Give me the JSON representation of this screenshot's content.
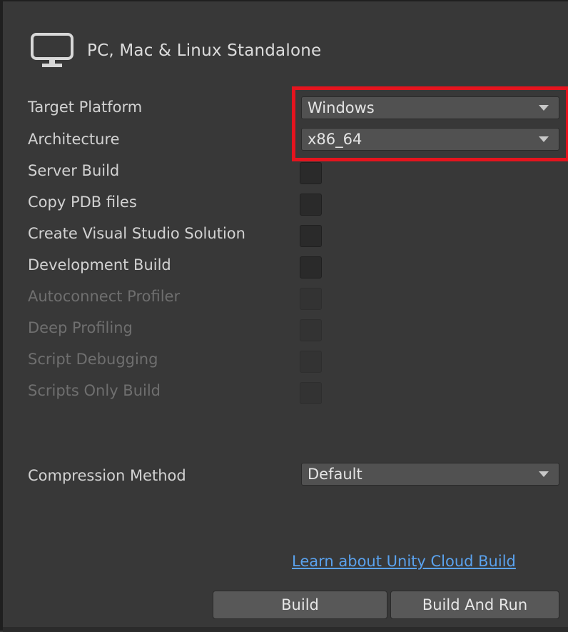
{
  "header": {
    "title": "PC, Mac & Linux Standalone",
    "icon": "monitor-icon"
  },
  "rows": {
    "target_platform": {
      "label": "Target Platform",
      "value": "Windows"
    },
    "architecture": {
      "label": "Architecture",
      "value": "x86_64"
    },
    "server_build": {
      "label": "Server Build"
    },
    "copy_pdb": {
      "label": "Copy PDB files"
    },
    "vs_solution": {
      "label": "Create Visual Studio Solution"
    },
    "development_build": {
      "label": "Development Build"
    },
    "autoconnect_profiler": {
      "label": "Autoconnect Profiler"
    },
    "deep_profiling": {
      "label": "Deep Profiling"
    },
    "script_debugging": {
      "label": "Script Debugging"
    },
    "scripts_only": {
      "label": "Scripts Only Build"
    },
    "compression": {
      "label": "Compression Method",
      "value": "Default"
    }
  },
  "link": {
    "text": "Learn about Unity Cloud Build"
  },
  "buttons": {
    "build": "Build",
    "build_and_run": "Build And Run"
  },
  "colors": {
    "background": "#383838",
    "highlight": "#e5141e",
    "link": "#5aa2ee"
  }
}
